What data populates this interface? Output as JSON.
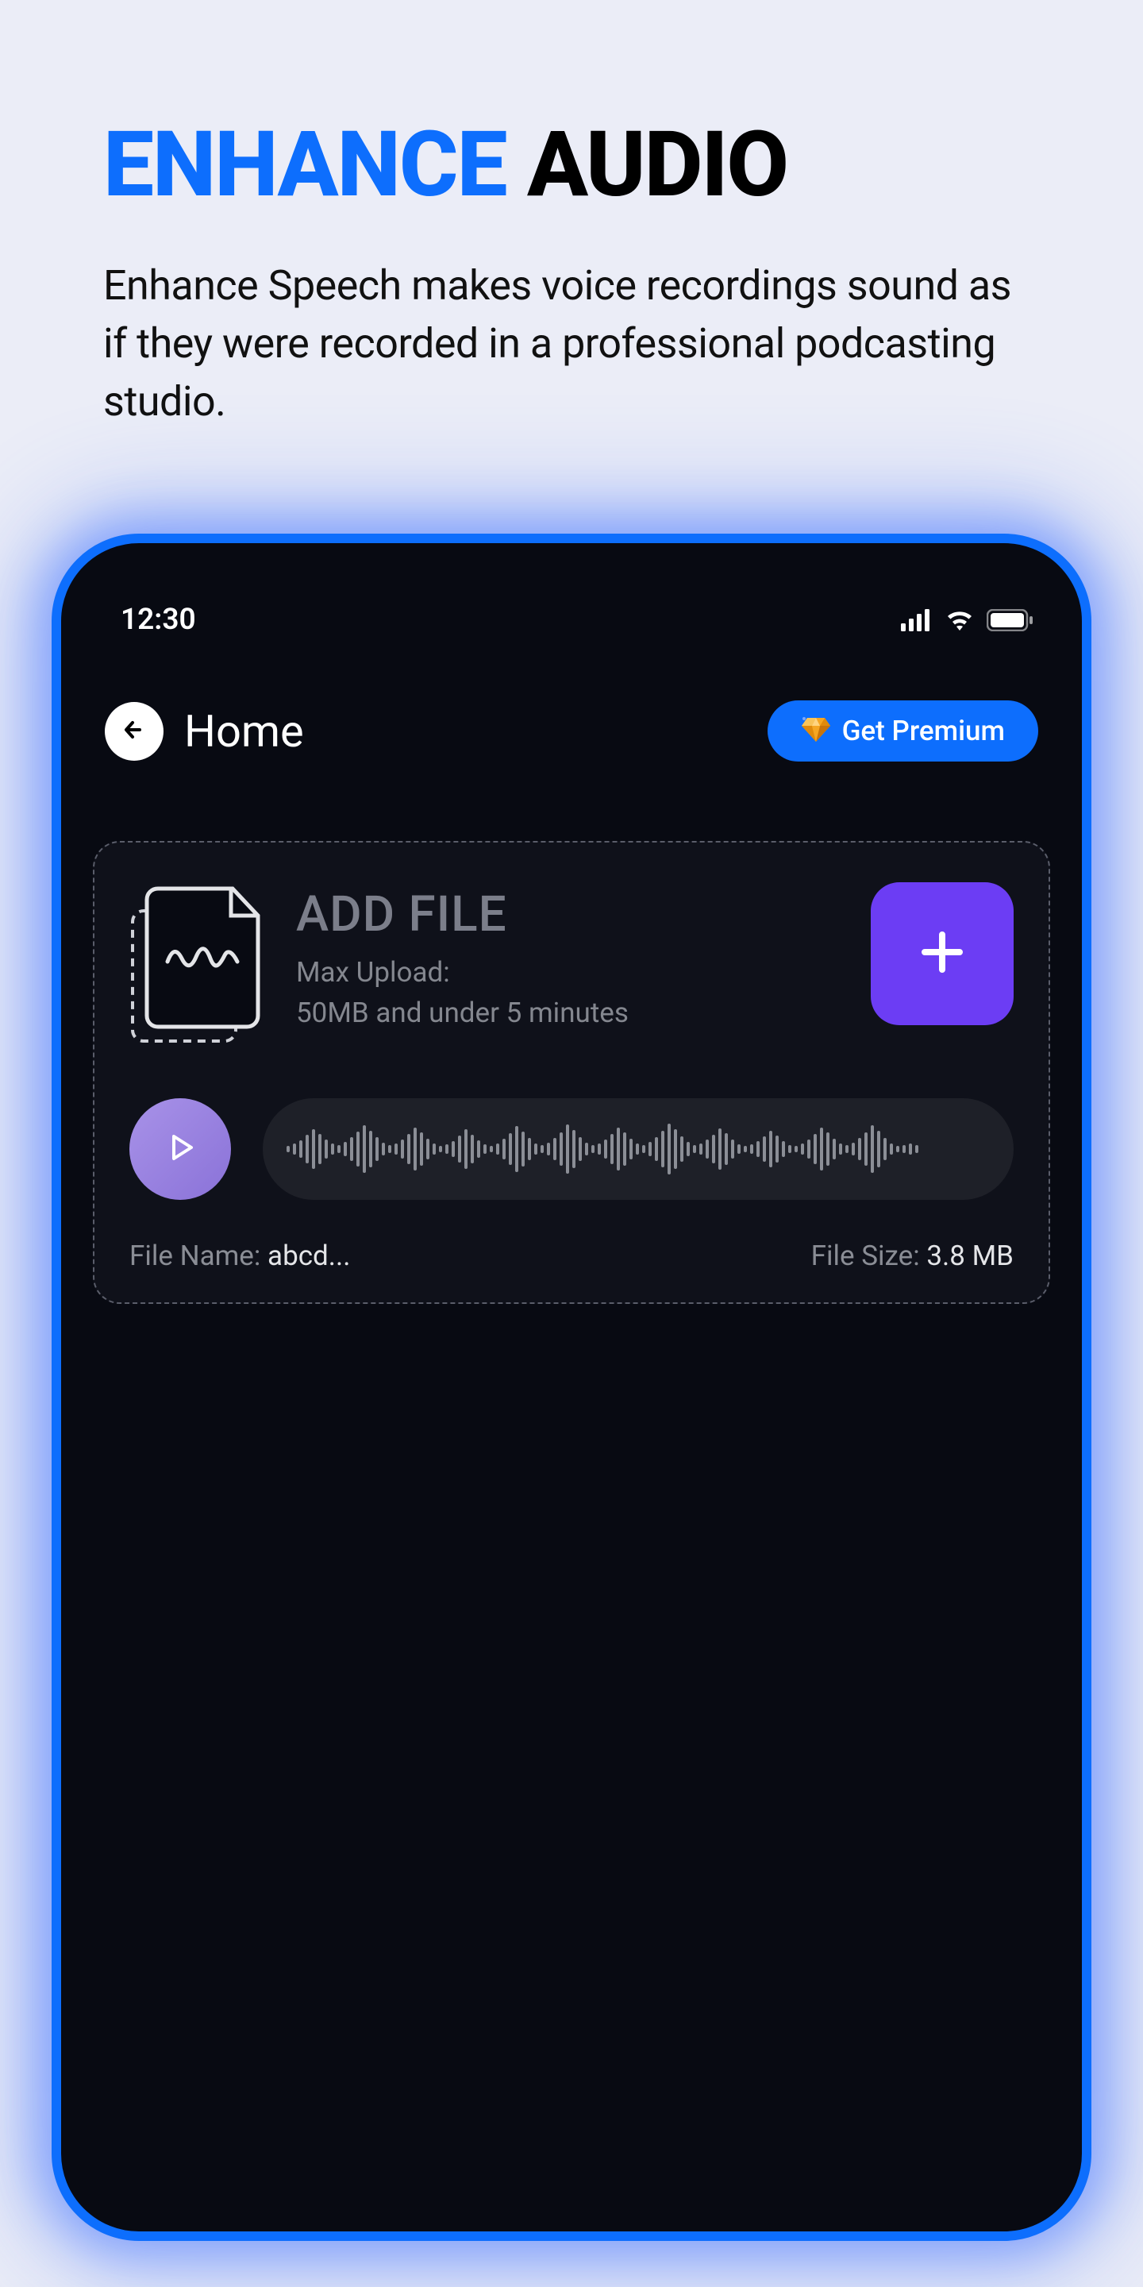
{
  "hero": {
    "title_primary": "ENHANCE",
    "title_secondary": "AUDIO",
    "subtitle": "Enhance Speech makes voice recordings sound as if they were recorded in a professional podcasting studio."
  },
  "status": {
    "time": "12:30"
  },
  "header": {
    "title": "Home",
    "premium_label": "Get Premium"
  },
  "upload": {
    "add_file_label": "ADD FILE",
    "max_upload_label": "Max Upload:",
    "max_upload_limit": "50MB and under 5 minutes"
  },
  "file": {
    "name_label": "File Name: ",
    "name_value": "abcd...",
    "size_label": "File Size: ",
    "size_value": "3.8 MB"
  },
  "colors": {
    "accent_blue": "#0d6efd",
    "accent_purple": "#6c3df4",
    "bg_dark": "#080a12",
    "bg_light": "#ebedf7"
  }
}
